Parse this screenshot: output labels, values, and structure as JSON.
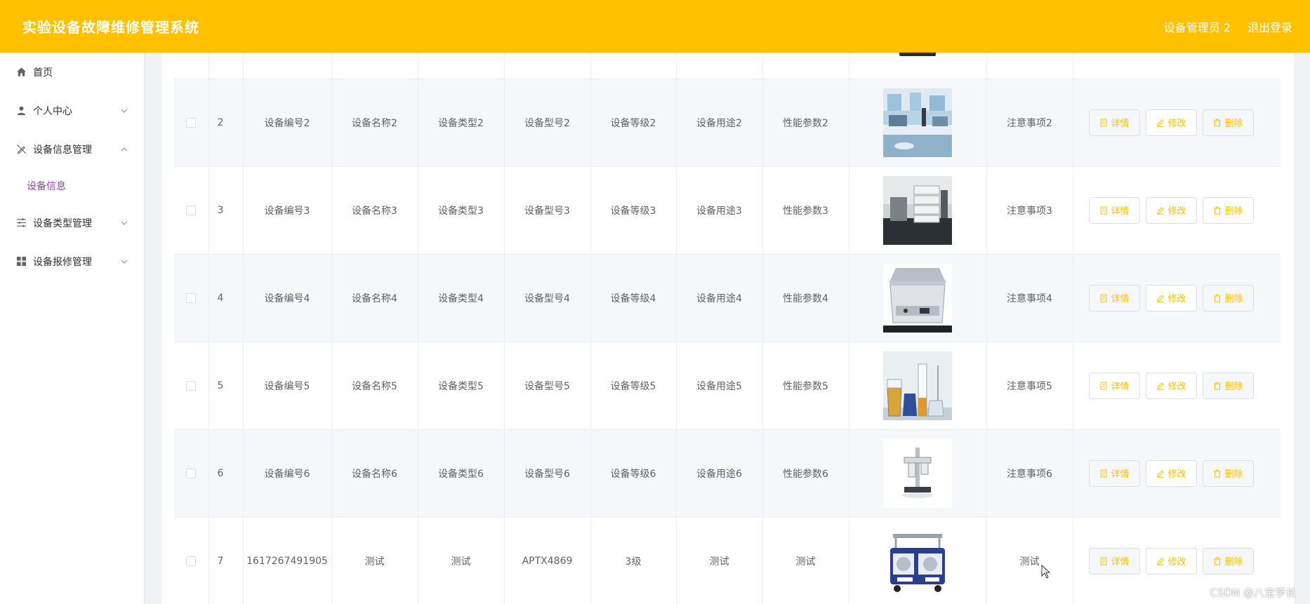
{
  "header": {
    "title": "实验设备故障维修管理系统",
    "user": "设备管理员 2",
    "logout": "退出登录",
    "bg_color": "#ffc000"
  },
  "sidebar": {
    "items": [
      {
        "label": "首页",
        "icon": "home-icon"
      },
      {
        "label": "个人中心",
        "icon": "user-icon",
        "expanded": false
      },
      {
        "label": "设备信息管理",
        "icon": "no-edit-icon",
        "expanded": true
      },
      {
        "label": "设备类型管理",
        "icon": "sliders-icon",
        "expanded": false
      },
      {
        "label": "设备报修管理",
        "icon": "grid-icon",
        "expanded": false
      }
    ],
    "subitem": {
      "label": "设备信息",
      "color": "#8e44ad"
    }
  },
  "table": {
    "rows": [
      {
        "index": "2",
        "code": "设备编号2",
        "name": "设备名称2",
        "type": "设备类型2",
        "model": "设备型号2",
        "level": "设备等级2",
        "usage": "设备用途2",
        "params": "性能参数2",
        "image": "lab-room-photo",
        "notes": "注意事项2"
      },
      {
        "index": "3",
        "code": "设备编号3",
        "name": "设备名称3",
        "type": "设备类型3",
        "model": "设备型号3",
        "level": "设备等级3",
        "usage": "设备用途3",
        "params": "性能参数3",
        "image": "chromatograph-photo",
        "notes": "注意事项3"
      },
      {
        "index": "4",
        "code": "设备编号4",
        "name": "设备名称4",
        "type": "设备类型4",
        "model": "设备型号4",
        "level": "设备等级4",
        "usage": "设备用途4",
        "params": "性能参数4",
        "image": "ultrasonic-cleaner-photo",
        "notes": "注意事项4"
      },
      {
        "index": "5",
        "code": "设备编号5",
        "name": "设备名称5",
        "type": "设备类型5",
        "model": "设备型号5",
        "level": "设备等级5",
        "usage": "设备用途5",
        "params": "性能参数5",
        "image": "glassware-photo",
        "notes": "注意事项5"
      },
      {
        "index": "6",
        "code": "设备编号6",
        "name": "设备名称6",
        "type": "设备类型6",
        "model": "设备型号6",
        "level": "设备等级6",
        "usage": "设备用途6",
        "params": "性能参数6",
        "image": "stand-apparatus-photo",
        "notes": "注意事项6"
      },
      {
        "index": "7",
        "code": "1617267491905",
        "name": "测试",
        "type": "测试",
        "model": "APTX4869",
        "level": "3级",
        "usage": "测试",
        "params": "测试",
        "image": "pump-unit-photo",
        "notes": "测试"
      }
    ],
    "actions": {
      "detail": "详情",
      "edit": "修改",
      "delete": "删除"
    }
  },
  "watermark": "CSDN @八宝学长"
}
